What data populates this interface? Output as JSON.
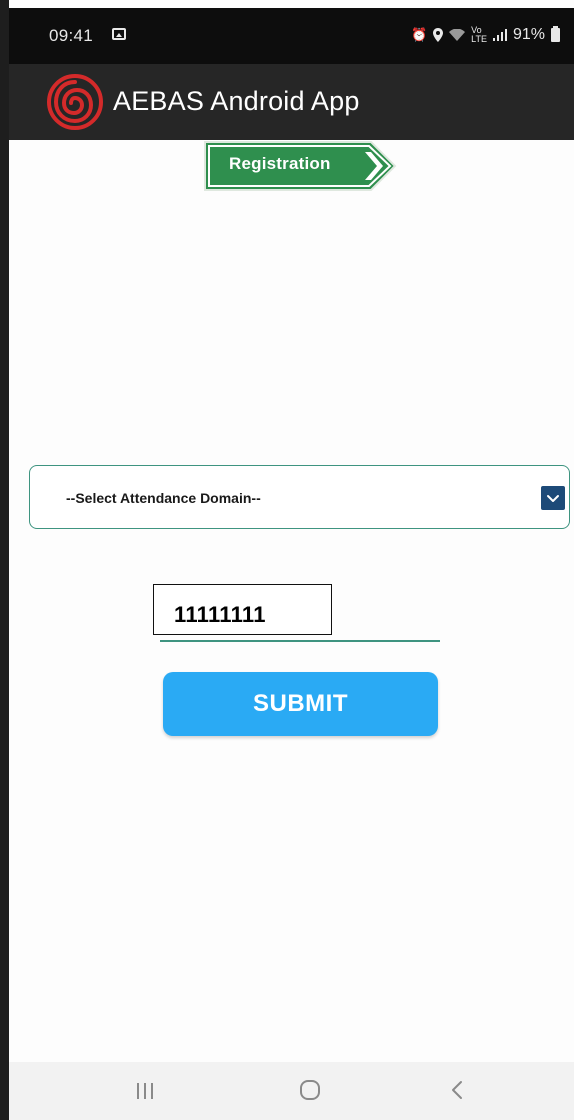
{
  "status_bar": {
    "time": "09:41",
    "battery": "91%",
    "icons": [
      "photo-icon",
      "alarm-icon",
      "location-icon",
      "wifi-icon",
      "volte-icon",
      "signal-icon",
      "battery-icon"
    ]
  },
  "app_bar": {
    "title": "AEBAS Android App",
    "logo_icon": "fingerprint-logo-icon"
  },
  "registration": {
    "label": "Registration"
  },
  "domain_select": {
    "selected": "--Select Attendance Domain--"
  },
  "id_input": {
    "value": "11111111"
  },
  "submit": {
    "label": "SUBMIT"
  },
  "colors": {
    "app_bar": "#262626",
    "registration_green": "#2f8f4e",
    "outline_teal": "#3e9480",
    "dropdown_navy": "#1d4a78",
    "submit_blue": "#2aaaf4",
    "logo_red": "#d42a2a"
  },
  "nav_bar": {
    "icons": [
      "recents-icon",
      "home-icon",
      "back-icon"
    ]
  }
}
